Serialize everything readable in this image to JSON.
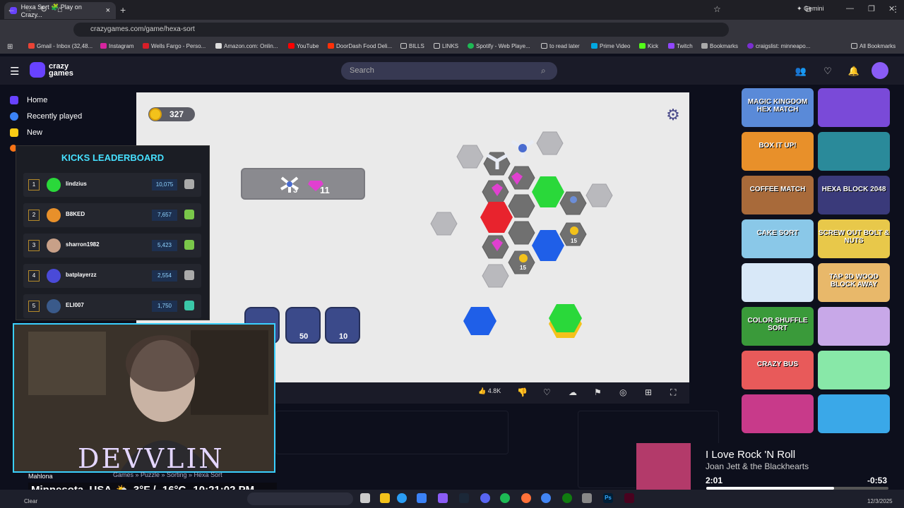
{
  "browser": {
    "tab_title": "Hexa Sort 🧩 Play on Crazy...",
    "gemini_label": "Gemini",
    "url": "crazygames.com/game/hexa-sort",
    "bookmarks": [
      "Gmail - Inbox (32,48...",
      "Instagram",
      "Wells Fargo - Perso...",
      "Amazon.com: Onlin...",
      "YouTube",
      "DoorDash Food Deli...",
      "BILLS",
      "LINKS",
      "Spotify - Web Playe...",
      "to read later",
      "Prime Video",
      "Kick",
      "Twitch",
      "Bookmarks",
      "craigslist: minneapo...",
      "All Bookmarks"
    ]
  },
  "site": {
    "logo_line1": "crazy",
    "logo_line2": "games",
    "search_placeholder": "Search",
    "sidebar": [
      "Home",
      "Recently played",
      "New"
    ]
  },
  "game": {
    "coins": "327",
    "goal_count_a": "3",
    "goal_count_b": "11",
    "powerup_costs": [
      "50",
      "10"
    ],
    "tile_labels": [
      "15",
      "15"
    ],
    "likes": "4.8K"
  },
  "leaderboard": {
    "title": "KICKS LEADERBOARD",
    "rows": [
      {
        "rank": "1",
        "name": "lindzius",
        "score": "10,075"
      },
      {
        "rank": "2",
        "name": "B8KED",
        "score": "7,657"
      },
      {
        "rank": "3",
        "name": "sharron1982",
        "score": "5,423"
      },
      {
        "rank": "4",
        "name": "batplayerzz",
        "score": "2,554"
      },
      {
        "rank": "5",
        "name": "ELI007",
        "score": "1,750"
      }
    ]
  },
  "stream": {
    "name": "DEVVLIN",
    "location": "Minnesota, USA",
    "weather": "3°F / -16°C",
    "time": "10:21:02 PM",
    "crumbs": "Games » Puzzle » Sorting » Hexa Sort",
    "user": "Mahlona"
  },
  "games_list": [
    "MAGIC KINGDOM HEX MATCH",
    "",
    "BOX IT UP!",
    "",
    "COFFEE MATCH",
    "HEXA BLOCK 2048",
    "CAKE SORT",
    "SCREW OUT BOLT & NUTS",
    "",
    "TAP 3D WOOD BLOCK AWAY",
    "COLOR SHUFFLE SORT",
    "",
    "CRAZY BUS",
    "",
    "",
    ""
  ],
  "music": {
    "song": "I Love Rock 'N Roll",
    "artist": "Joan Jett & the Blackhearts",
    "elapsed": "2:01",
    "remaining": "-0:53",
    "progress": 0.7
  },
  "taskbar": {
    "weather": "Clear",
    "date": "12/3/2025"
  },
  "colors": {
    "accent": "#6842ff",
    "red": "#e8232d",
    "blue": "#1f5fe8",
    "green": "#2ad83a",
    "pink": "#e040d0"
  }
}
